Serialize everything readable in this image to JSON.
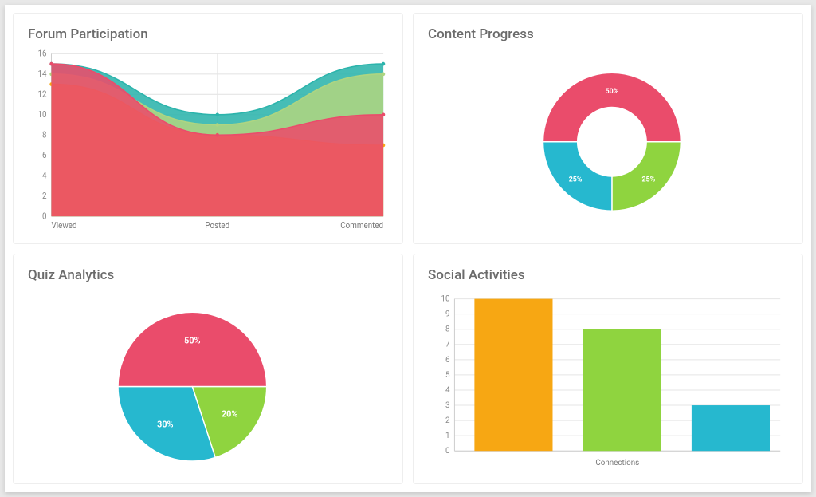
{
  "cards": {
    "forum": {
      "title": "Forum Participation"
    },
    "content": {
      "title": "Content Progress"
    },
    "quiz": {
      "title": "Quiz Analytics"
    },
    "social": {
      "title": "Social Activities"
    }
  },
  "colors": {
    "pink": "#ea4c6b",
    "green": "#8fd43f",
    "teal": "#2cb4ac",
    "cyan": "#26b8cf",
    "orange": "#f7a713",
    "lime": "#aed581"
  },
  "chart_data": [
    {
      "id": "forum",
      "type": "area",
      "title": "Forum Participation",
      "categories": [
        "Viewed",
        "Posted",
        "Commented"
      ],
      "ylim": [
        0,
        16
      ],
      "yticks": [
        0,
        2,
        4,
        6,
        8,
        10,
        12,
        14,
        16
      ],
      "series": [
        {
          "name": "teal",
          "color": "#2cb4ac",
          "values": [
            15,
            10,
            15
          ]
        },
        {
          "name": "lime",
          "color": "#aed581",
          "values": [
            14,
            9,
            14
          ]
        },
        {
          "name": "orange",
          "color": "#f7a713",
          "values": [
            13,
            8,
            7
          ]
        },
        {
          "name": "pink",
          "color": "#ea4c6b",
          "values": [
            15,
            8,
            10
          ]
        }
      ]
    },
    {
      "id": "content",
      "type": "donut",
      "title": "Content Progress",
      "slices": [
        {
          "label": "50%",
          "value": 50,
          "color": "#ea4c6b"
        },
        {
          "label": "25%",
          "value": 25,
          "color": "#8fd43f"
        },
        {
          "label": "25%",
          "value": 25,
          "color": "#26b8cf"
        }
      ]
    },
    {
      "id": "quiz",
      "type": "pie",
      "title": "Quiz Analytics",
      "slices": [
        {
          "label": "50%",
          "value": 50,
          "color": "#ea4c6b"
        },
        {
          "label": "20%",
          "value": 20,
          "color": "#8fd43f"
        },
        {
          "label": "30%",
          "value": 30,
          "color": "#26b8cf"
        }
      ]
    },
    {
      "id": "social",
      "type": "bar",
      "title": "Social Activities",
      "xlabel": "Connections",
      "ylim": [
        0,
        10
      ],
      "yticks": [
        0,
        1,
        2,
        3,
        4,
        5,
        6,
        7,
        8,
        9,
        10
      ],
      "bars": [
        {
          "value": 10,
          "color": "#f7a713"
        },
        {
          "value": 8,
          "color": "#8fd43f"
        },
        {
          "value": 3,
          "color": "#26b8cf"
        }
      ]
    }
  ]
}
